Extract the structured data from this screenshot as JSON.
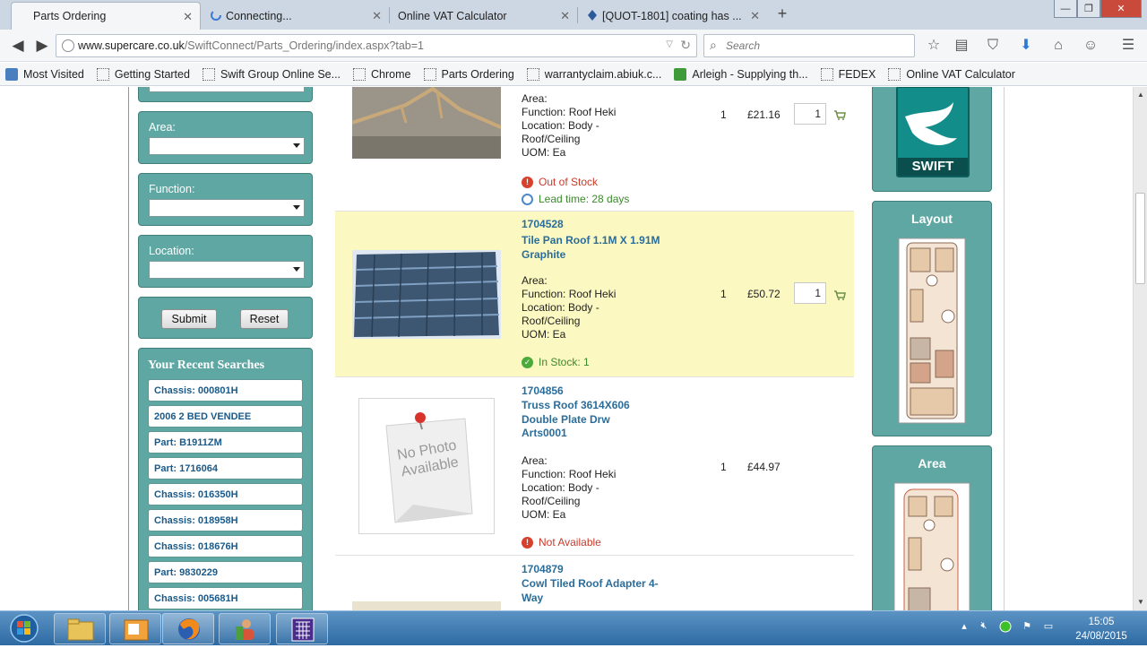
{
  "browser": {
    "tabs": [
      {
        "title": "Parts Ordering",
        "active": true
      },
      {
        "title": "Connecting...",
        "active": false
      },
      {
        "title": "Online VAT Calculator",
        "active": false
      },
      {
        "title": "[QUOT-1801] coating has ...",
        "active": false
      }
    ],
    "url": {
      "host": "www.supercare.co.uk",
      "path": "/SwiftConnect/Parts_Ordering/index.aspx?tab=1"
    },
    "search_placeholder": "Search",
    "bookmarks": [
      {
        "label": "Most Visited",
        "icon": "folder"
      },
      {
        "label": "Getting Started",
        "icon": "page"
      },
      {
        "label": "Swift Group Online Se...",
        "icon": "page"
      },
      {
        "label": "Chrome",
        "icon": "page"
      },
      {
        "label": "Parts Ordering",
        "icon": "page"
      },
      {
        "label": "warrantyclaim.abiuk.c...",
        "icon": "page"
      },
      {
        "label": "Arleigh - Supplying th...",
        "icon": "green"
      },
      {
        "label": "FEDEX",
        "icon": "page"
      },
      {
        "label": "Online VAT Calculator",
        "icon": "page"
      }
    ]
  },
  "filters": {
    "area_label": "Area:",
    "function_label": "Function:",
    "location_label": "Location:",
    "submit_label": "Submit",
    "reset_label": "Reset"
  },
  "recent": {
    "title": "Your Recent Searches",
    "items": [
      "Chassis: 000801H",
      "2006 2 BED VENDEE",
      "Part: B1911ZM",
      "Part: 1716064",
      "Chassis: 016350H",
      "Chassis: 018958H",
      "Chassis: 018676H",
      "Part: 9830229",
      "Chassis: 005681H"
    ]
  },
  "products": [
    {
      "code": "",
      "name": "",
      "area": "Area:",
      "function": "Function: Roof Heki",
      "location": "Location: Body - Roof/Ceiling",
      "uom": "UOM: Ea",
      "qty": "1",
      "price": "£21.16",
      "order_qty": "1",
      "status": "Out of Stock",
      "lead_time": "Lead time: 28 days"
    },
    {
      "code": "1704528",
      "name": "Tile Pan Roof 1.1M X 1.91M Graphite",
      "area": "Area:",
      "function": "Function: Roof Heki",
      "location": "Location: Body - Roof/Ceiling",
      "uom": "UOM: Ea",
      "qty": "1",
      "price": "£50.72",
      "order_qty": "1",
      "status": "In Stock: 1"
    },
    {
      "code": "1704856",
      "name": "Truss Roof 3614X606 Double Plate Drw Arts0001",
      "area": "Area:",
      "function": "Function: Roof Heki",
      "location": "Location: Body - Roof/Ceiling",
      "uom": "UOM: Ea",
      "qty": "1",
      "price": "£44.97",
      "status": "Not Available",
      "image_text": "No Photo Available"
    },
    {
      "code": "1704879",
      "name": "Cowl Tiled Roof Adapter 4-Way"
    }
  ],
  "right": {
    "logo_text": "SWIFT",
    "layout_title": "Layout",
    "area_title": "Area"
  },
  "taskbar": {
    "time": "15:05",
    "date": "24/08/2015"
  },
  "colors": {
    "panel_teal": "#5fa7a3",
    "highlight_row": "#fbf8c1",
    "link_blue": "#2b6d9a",
    "status_red": "#c83a2a",
    "status_green": "#3a8a2a"
  }
}
